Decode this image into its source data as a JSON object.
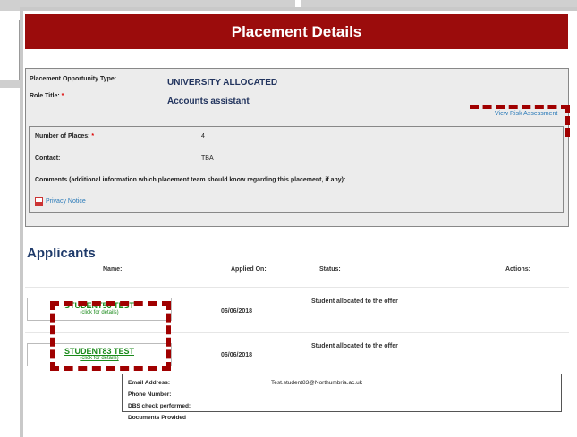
{
  "page": {
    "title": "Placement Details"
  },
  "details": {
    "opportunity_type_label": "Placement Opportunity Type:",
    "opportunity_type_value": "UNIVERSITY ALLOCATED",
    "role_title_label": "Role Title:",
    "role_title_value": "Accounts assistant",
    "required_mark": "*",
    "view_risk_link": "View Risk Assessment"
  },
  "inner": {
    "places_label": "Number of Places:",
    "places_value": "4",
    "contact_label": "Contact:",
    "contact_value": "TBA",
    "comments_label": "Comments (additional information which placement team should know regarding this placement, if any):",
    "privacy_link": "Privacy Notice"
  },
  "applicants": {
    "title": "Applicants",
    "columns": [
      "Name:",
      "Applied On:",
      "Status:",
      "Actions:"
    ],
    "rows": [
      {
        "name": "STUDENT56 TEST",
        "details": "(click for details)",
        "applied_on": "06/06/2018",
        "status": "Student allocated to the offer"
      },
      {
        "name": "STUDENT83 TEST",
        "details": "(click for details)",
        "applied_on": "06/06/2018",
        "status": "Student allocated to the offer"
      }
    ],
    "expanded": {
      "email_label": "Email Address:",
      "email_value": "Test.student83@Northumbria.ac.uk",
      "phone_label": "Phone Number:",
      "dbs_label": "DBS check performed:",
      "docs_label": "Documents Provided"
    }
  },
  "colors": {
    "header_bg": "#9b0c0c",
    "annotation": "#a00000"
  }
}
